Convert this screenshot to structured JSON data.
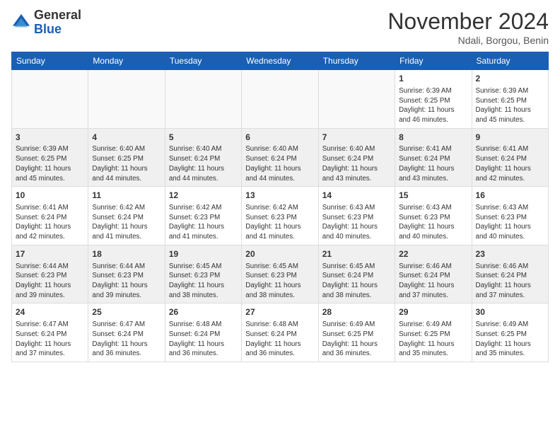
{
  "logo": {
    "general": "General",
    "blue": "Blue"
  },
  "header": {
    "month": "November 2024",
    "location": "Ndali, Borgou, Benin"
  },
  "days_of_week": [
    "Sunday",
    "Monday",
    "Tuesday",
    "Wednesday",
    "Thursday",
    "Friday",
    "Saturday"
  ],
  "weeks": [
    {
      "shaded": false,
      "days": [
        {
          "num": "",
          "info": ""
        },
        {
          "num": "",
          "info": ""
        },
        {
          "num": "",
          "info": ""
        },
        {
          "num": "",
          "info": ""
        },
        {
          "num": "",
          "info": ""
        },
        {
          "num": "1",
          "info": "Sunrise: 6:39 AM\nSunset: 6:25 PM\nDaylight: 11 hours\nand 46 minutes."
        },
        {
          "num": "2",
          "info": "Sunrise: 6:39 AM\nSunset: 6:25 PM\nDaylight: 11 hours\nand 45 minutes."
        }
      ]
    },
    {
      "shaded": true,
      "days": [
        {
          "num": "3",
          "info": "Sunrise: 6:39 AM\nSunset: 6:25 PM\nDaylight: 11 hours\nand 45 minutes."
        },
        {
          "num": "4",
          "info": "Sunrise: 6:40 AM\nSunset: 6:25 PM\nDaylight: 11 hours\nand 44 minutes."
        },
        {
          "num": "5",
          "info": "Sunrise: 6:40 AM\nSunset: 6:24 PM\nDaylight: 11 hours\nand 44 minutes."
        },
        {
          "num": "6",
          "info": "Sunrise: 6:40 AM\nSunset: 6:24 PM\nDaylight: 11 hours\nand 44 minutes."
        },
        {
          "num": "7",
          "info": "Sunrise: 6:40 AM\nSunset: 6:24 PM\nDaylight: 11 hours\nand 43 minutes."
        },
        {
          "num": "8",
          "info": "Sunrise: 6:41 AM\nSunset: 6:24 PM\nDaylight: 11 hours\nand 43 minutes."
        },
        {
          "num": "9",
          "info": "Sunrise: 6:41 AM\nSunset: 6:24 PM\nDaylight: 11 hours\nand 42 minutes."
        }
      ]
    },
    {
      "shaded": false,
      "days": [
        {
          "num": "10",
          "info": "Sunrise: 6:41 AM\nSunset: 6:24 PM\nDaylight: 11 hours\nand 42 minutes."
        },
        {
          "num": "11",
          "info": "Sunrise: 6:42 AM\nSunset: 6:24 PM\nDaylight: 11 hours\nand 41 minutes."
        },
        {
          "num": "12",
          "info": "Sunrise: 6:42 AM\nSunset: 6:23 PM\nDaylight: 11 hours\nand 41 minutes."
        },
        {
          "num": "13",
          "info": "Sunrise: 6:42 AM\nSunset: 6:23 PM\nDaylight: 11 hours\nand 41 minutes."
        },
        {
          "num": "14",
          "info": "Sunrise: 6:43 AM\nSunset: 6:23 PM\nDaylight: 11 hours\nand 40 minutes."
        },
        {
          "num": "15",
          "info": "Sunrise: 6:43 AM\nSunset: 6:23 PM\nDaylight: 11 hours\nand 40 minutes."
        },
        {
          "num": "16",
          "info": "Sunrise: 6:43 AM\nSunset: 6:23 PM\nDaylight: 11 hours\nand 40 minutes."
        }
      ]
    },
    {
      "shaded": true,
      "days": [
        {
          "num": "17",
          "info": "Sunrise: 6:44 AM\nSunset: 6:23 PM\nDaylight: 11 hours\nand 39 minutes."
        },
        {
          "num": "18",
          "info": "Sunrise: 6:44 AM\nSunset: 6:23 PM\nDaylight: 11 hours\nand 39 minutes."
        },
        {
          "num": "19",
          "info": "Sunrise: 6:45 AM\nSunset: 6:23 PM\nDaylight: 11 hours\nand 38 minutes."
        },
        {
          "num": "20",
          "info": "Sunrise: 6:45 AM\nSunset: 6:23 PM\nDaylight: 11 hours\nand 38 minutes."
        },
        {
          "num": "21",
          "info": "Sunrise: 6:45 AM\nSunset: 6:24 PM\nDaylight: 11 hours\nand 38 minutes."
        },
        {
          "num": "22",
          "info": "Sunrise: 6:46 AM\nSunset: 6:24 PM\nDaylight: 11 hours\nand 37 minutes."
        },
        {
          "num": "23",
          "info": "Sunrise: 6:46 AM\nSunset: 6:24 PM\nDaylight: 11 hours\nand 37 minutes."
        }
      ]
    },
    {
      "shaded": false,
      "days": [
        {
          "num": "24",
          "info": "Sunrise: 6:47 AM\nSunset: 6:24 PM\nDaylight: 11 hours\nand 37 minutes."
        },
        {
          "num": "25",
          "info": "Sunrise: 6:47 AM\nSunset: 6:24 PM\nDaylight: 11 hours\nand 36 minutes."
        },
        {
          "num": "26",
          "info": "Sunrise: 6:48 AM\nSunset: 6:24 PM\nDaylight: 11 hours\nand 36 minutes."
        },
        {
          "num": "27",
          "info": "Sunrise: 6:48 AM\nSunset: 6:24 PM\nDaylight: 11 hours\nand 36 minutes."
        },
        {
          "num": "28",
          "info": "Sunrise: 6:49 AM\nSunset: 6:25 PM\nDaylight: 11 hours\nand 36 minutes."
        },
        {
          "num": "29",
          "info": "Sunrise: 6:49 AM\nSunset: 6:25 PM\nDaylight: 11 hours\nand 35 minutes."
        },
        {
          "num": "30",
          "info": "Sunrise: 6:49 AM\nSunset: 6:25 PM\nDaylight: 11 hours\nand 35 minutes."
        }
      ]
    }
  ]
}
